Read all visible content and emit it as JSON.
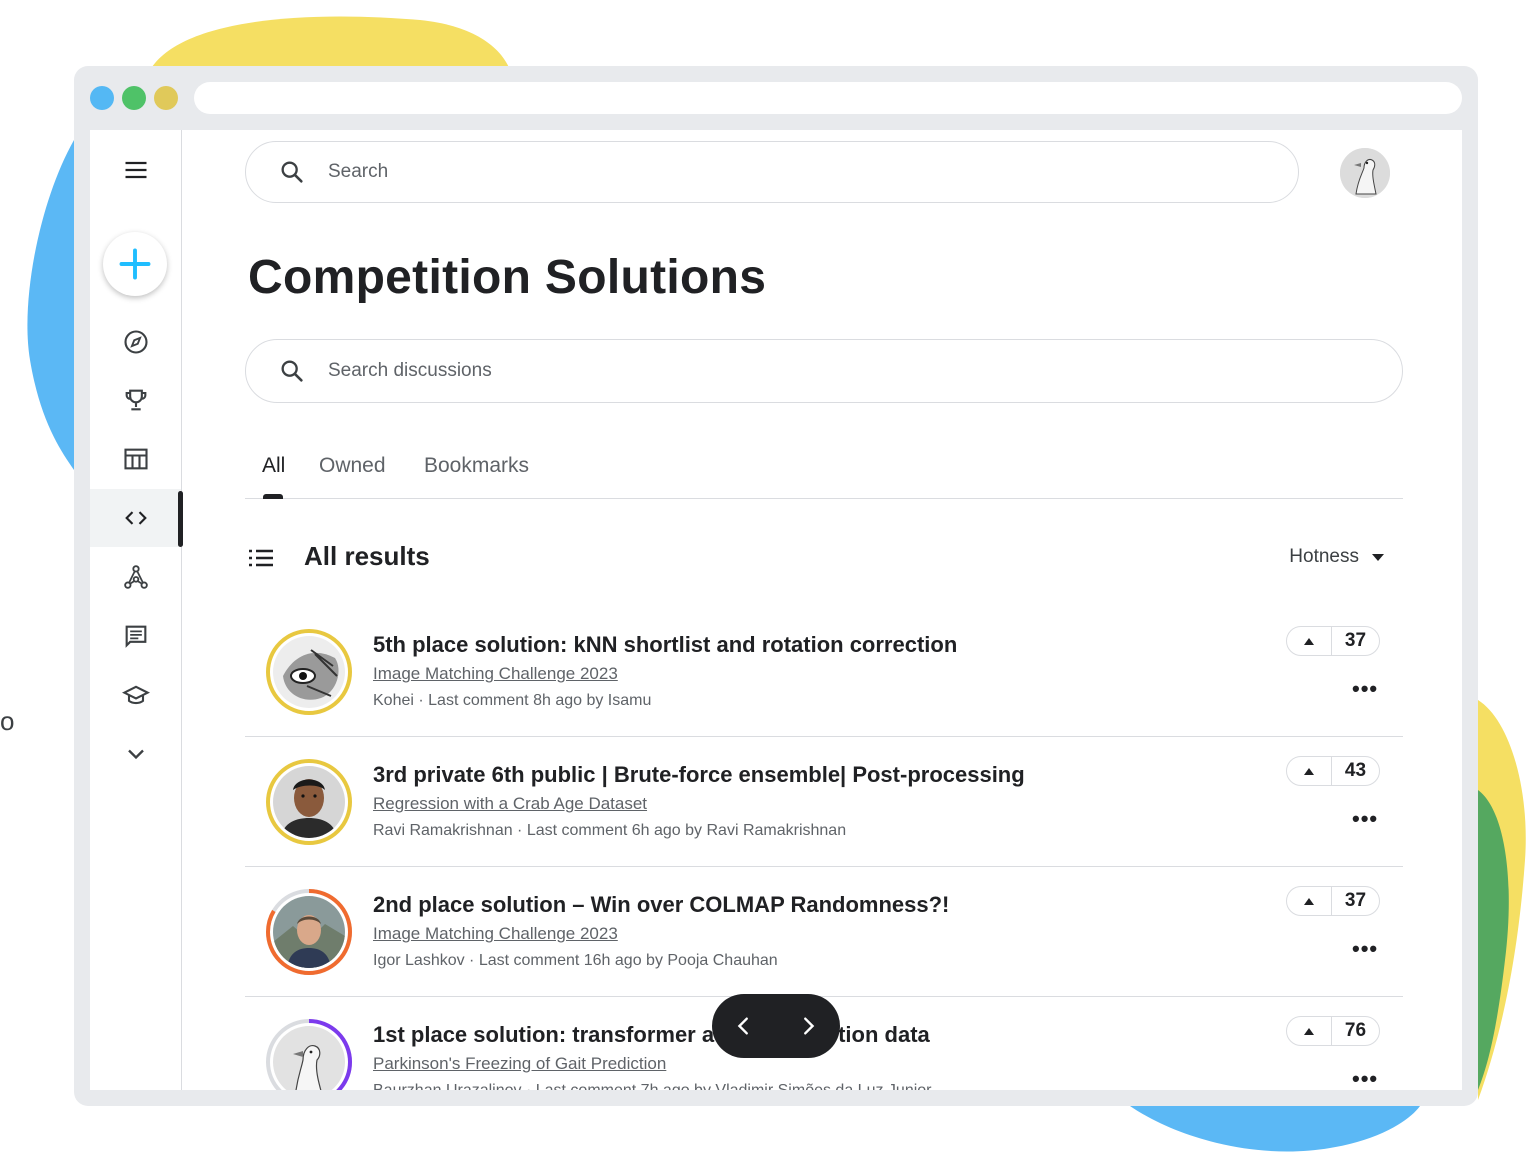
{
  "colors": {
    "dot_blue": "#54b8f4",
    "dot_green": "#4fc268",
    "dot_yellow": "#e0c95a",
    "blob_yellow": "#f5df63",
    "blob_blue": "#5bb8f5",
    "blob_green": "#55a860",
    "accent": "#20beff",
    "ring_gold": "#e8c840",
    "ring_orange": "#f06b2f",
    "ring_purple": "#7c3aed"
  },
  "search": {
    "placeholder": "Search"
  },
  "page": {
    "title": "Competition Solutions"
  },
  "discussion_search": {
    "placeholder": "Search discussions"
  },
  "tabs": [
    {
      "label": "All",
      "active": true
    },
    {
      "label": "Owned",
      "active": false
    },
    {
      "label": "Bookmarks",
      "active": false
    }
  ],
  "results": {
    "title": "All results",
    "sort_label": "Hotness"
  },
  "sidebar": {
    "items": [
      {
        "icon": "menu-icon"
      },
      {
        "icon": "create-icon"
      },
      {
        "icon": "compass-icon"
      },
      {
        "icon": "trophy-icon"
      },
      {
        "icon": "table-icon"
      },
      {
        "icon": "code-icon",
        "active": true
      },
      {
        "icon": "models-icon"
      },
      {
        "icon": "comment-icon"
      },
      {
        "icon": "school-icon"
      },
      {
        "icon": "chevron-down-icon"
      }
    ]
  },
  "discussions": [
    {
      "title": "5th place solution: kNN shortlist and rotation correction",
      "competition": "Image Matching Challenge 2023",
      "meta": "Kohei ·  Last comment 8h ago by Isamu",
      "votes": "37",
      "ring": "gold"
    },
    {
      "title": "3rd private 6th public | Brute-force ensemble| Post-processing",
      "competition": "Regression with a Crab Age Dataset",
      "meta": "Ravi Ramakrishnan · Last comment 6h ago by Ravi Ramakrishnan",
      "votes": "43",
      "ring": "gold"
    },
    {
      "title": "2nd place solution – Win over COLMAP Randomness?!",
      "competition": "Image Matching Challenge 2023",
      "meta": "Igor Lashkov · Last comment 16h ago by Pooja Chauhan",
      "votes": "37",
      "ring": "orange"
    },
    {
      "title": "1st place solution: transformer a",
      "title_tail": "tion data",
      "competition": "Parkinson's Freezing of Gait Prediction",
      "meta": "Baurzhan Urazalinov · Last comment 7h ago by Vladimir Simões da Luz Junior",
      "votes": "76",
      "ring": "purple"
    }
  ],
  "side_char": "o"
}
